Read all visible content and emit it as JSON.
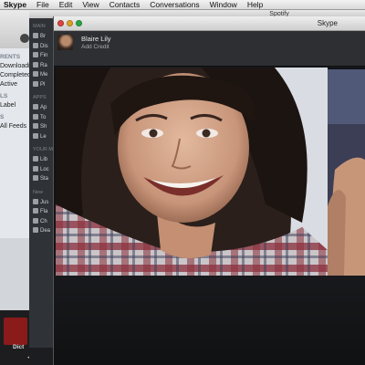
{
  "menubar": {
    "app": "Skype",
    "items": [
      "File",
      "Edit",
      "View",
      "Contacts",
      "Conversations",
      "Window",
      "Help"
    ]
  },
  "background_window": {
    "section_1": "RENTS",
    "rows_1": [
      "Downloadi",
      "Completed",
      "Active"
    ],
    "section_2": "LS",
    "rows_2": [
      "Label"
    ],
    "section_3": "S",
    "rows_3": [
      "All Feeds"
    ]
  },
  "dock": {
    "label": "Dict"
  },
  "spotify": {
    "title": "Spotify",
    "section_main": "MAIN",
    "main_items": [
      "Br",
      "Dis",
      "Fin",
      "Ra",
      "Me",
      "Pl"
    ],
    "section_apps": "APPS",
    "apps_items": [
      "Ap",
      "To",
      "Sh",
      "Le"
    ],
    "section_your": "YOUR M",
    "your_items": [
      "Lib",
      "Loc",
      "Sta"
    ],
    "section_new": "New",
    "new_items": [
      "Jus",
      "Fla",
      "Ch",
      "Dea"
    ]
  },
  "skype": {
    "window_title": "Skype",
    "contact": {
      "name": "Blaire Lily",
      "subtitle": "Add Credit"
    }
  }
}
